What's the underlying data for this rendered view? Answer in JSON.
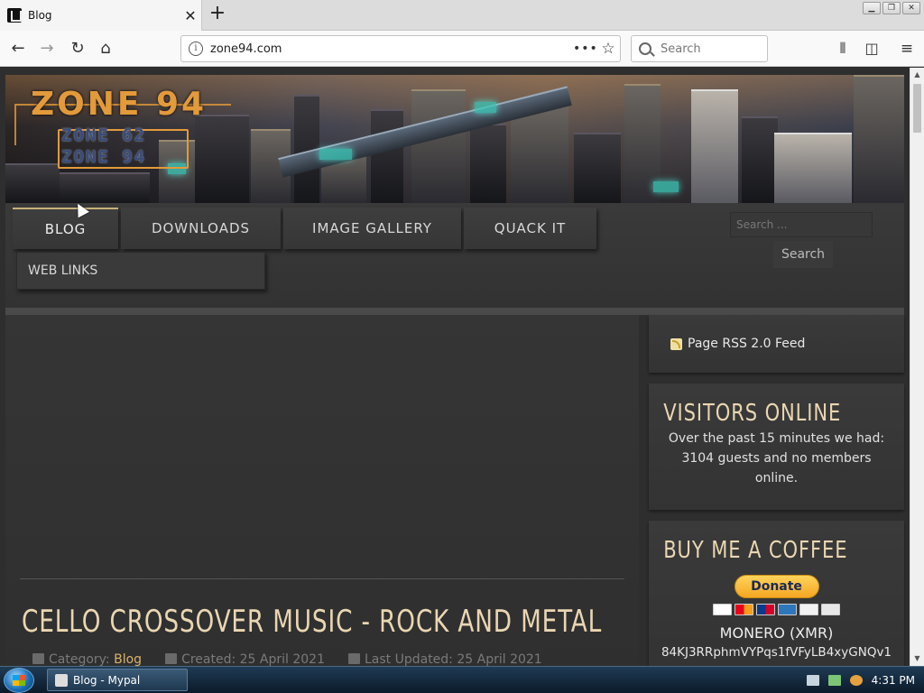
{
  "browser": {
    "tab_title": "Blog",
    "tab_close": "✕",
    "new_tab": "+",
    "url": "zone94.com",
    "more_actions": "•••",
    "search_placeholder": "Search",
    "window_buttons": [
      "▁",
      "❐",
      "✕"
    ]
  },
  "site": {
    "logo_main": "ZONE 94",
    "logo_line2": "ZONE 62",
    "logo_line3": "ZONE 94",
    "menu": [
      {
        "label": "BLOG",
        "active": true
      },
      {
        "label": "DOWNLOADS",
        "active": false
      },
      {
        "label": "IMAGE GALLERY",
        "active": false
      },
      {
        "label": "QUACK IT",
        "active": false
      },
      {
        "label": "WEB LINKS",
        "active": false
      }
    ],
    "search_placeholder": "Search ...",
    "search_button": "Search"
  },
  "article": {
    "title": "CELLO CROSSOVER MUSIC - ROCK AND METAL",
    "category_label": "Category:",
    "category": "Blog",
    "created": "Created: 25 April 2021",
    "updated": "Last Updated: 25 April 2021"
  },
  "sidebar": {
    "rss_label": "Page RSS 2.0 Feed",
    "visitors_title": "VISITORS ONLINE",
    "visitors_text": "Over the past 15 minutes we had: 3104 guests and no members online.",
    "coffee_title": "BUY ME A COFFEE",
    "donate_label": "Donate",
    "coin_label": "MONERO (XMR)",
    "coin_address": "84KJ3RRphmVYPqs1fVFyLB4xyGNQv1"
  },
  "taskbar": {
    "window_label": "Blog - Mypal",
    "clock": "4:31 PM"
  }
}
